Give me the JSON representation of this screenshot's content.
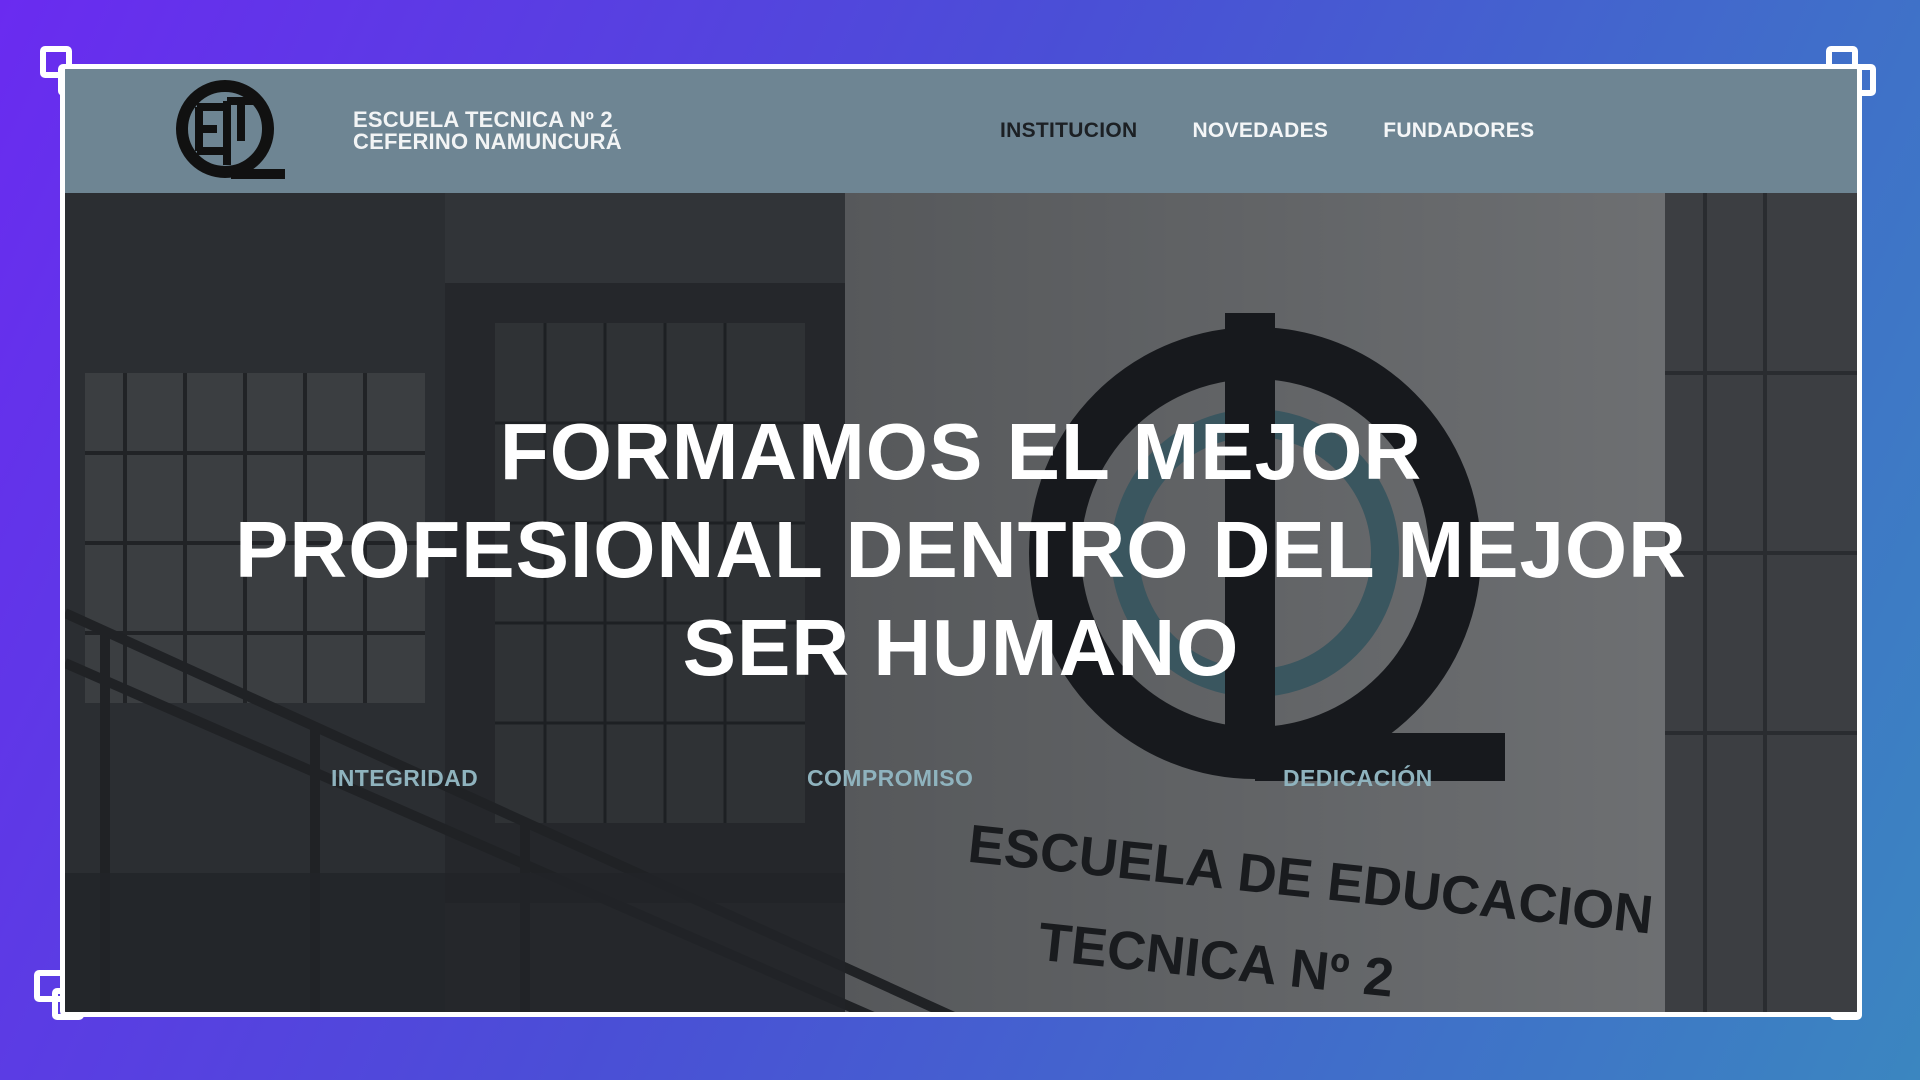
{
  "header": {
    "brand_line1": "ESCUELA TECNICA Nº 2",
    "brand_line2": "CEFERINO NAMUNCURÁ",
    "nav": [
      {
        "label": "INSTITUCION",
        "active": true
      },
      {
        "label": "NOVEDADES",
        "active": false
      },
      {
        "label": "FUNDADORES",
        "active": false
      }
    ]
  },
  "hero": {
    "headline_lines": [
      "FORMAMOS EL MEJOR",
      "PROFESIONAL DENTRO DEL MEJOR",
      "SER HUMANO"
    ],
    "values": [
      "INTEGRIDAD",
      "COMPROMISO",
      "DEDICACIÓN"
    ],
    "wall_text_line1": "ESCUELA DE EDUCACION",
    "wall_text_line2": "TECNICA Nº 2"
  },
  "colors": {
    "header_bg": "#6e8593",
    "accent_values": "#8fb3be",
    "nav_active": "#1c2024"
  }
}
